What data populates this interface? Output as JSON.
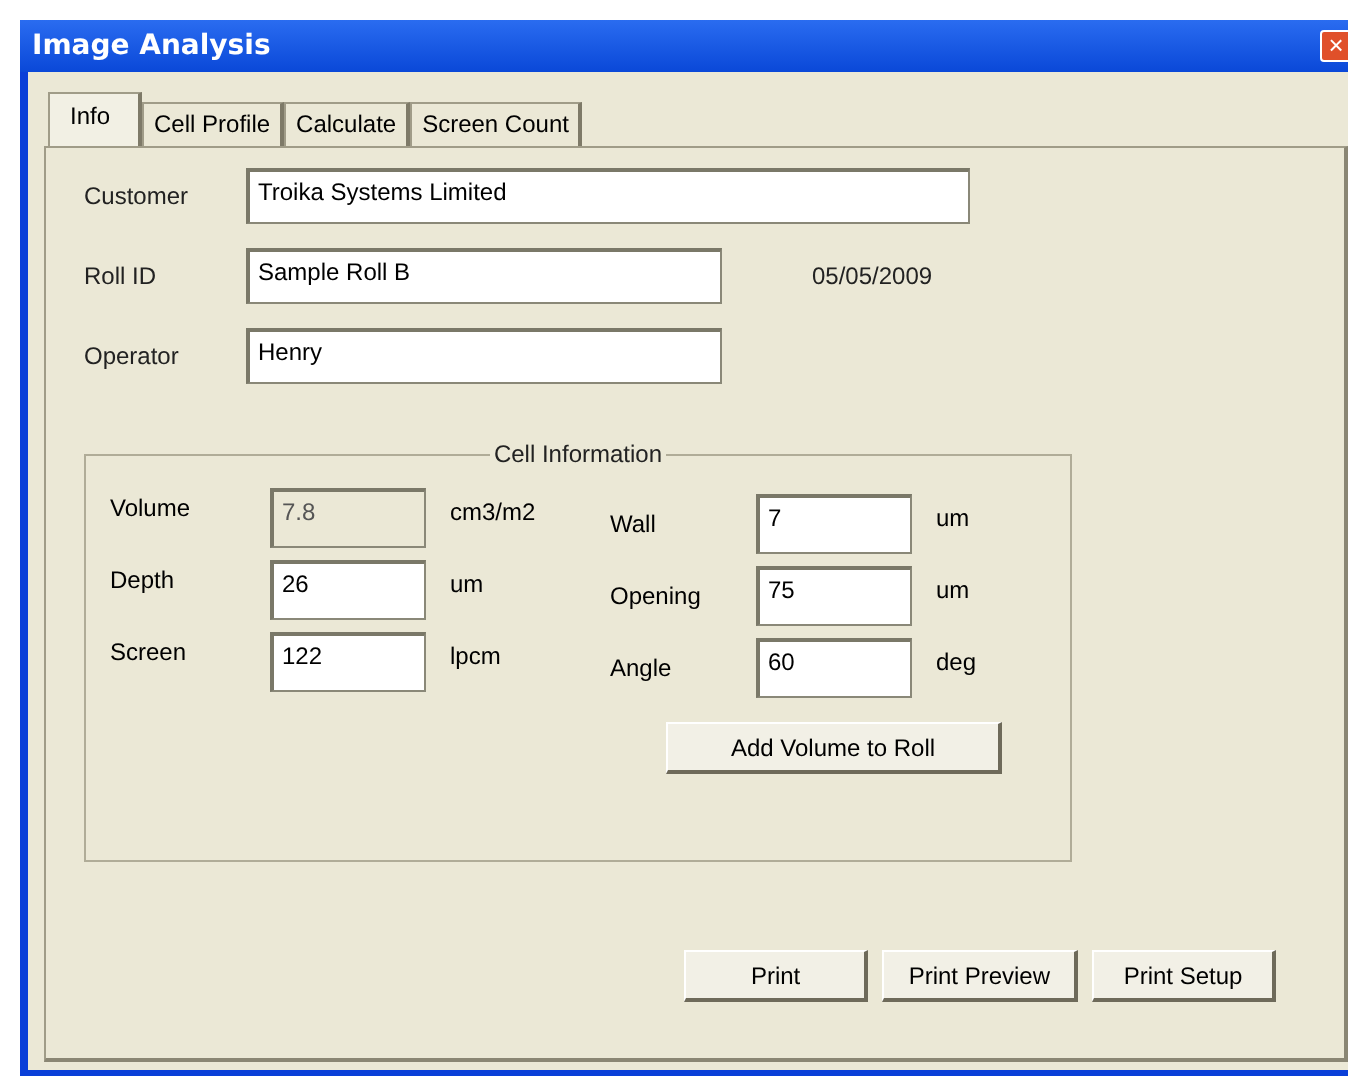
{
  "window": {
    "title": "Image Analysis",
    "close": "×"
  },
  "tabs": [
    {
      "label": "Info",
      "selected": true
    },
    {
      "label": "Cell Profile",
      "selected": false
    },
    {
      "label": "Calculate",
      "selected": false
    },
    {
      "label": "Screen Count",
      "selected": false
    }
  ],
  "fields": [
    {
      "label": "Customer",
      "value": "Troika Systems Limited"
    },
    {
      "label": "Roll ID",
      "value": "Sample Roll B",
      "date": "05/05/2009"
    },
    {
      "label": "Operator",
      "value": "Henry"
    }
  ],
  "cell_information": {
    "title": "Cell Information",
    "left": [
      {
        "label": "Volume",
        "value": "7.8",
        "unit": "cm3/m2",
        "disabled": true
      },
      {
        "label": "Depth",
        "value": "26",
        "unit": "um",
        "disabled": false
      },
      {
        "label": "Screen",
        "value": "122",
        "unit": "lpcm",
        "disabled": false
      }
    ],
    "right": [
      {
        "label": "Wall",
        "value": "7",
        "unit": "um",
        "disabled": false
      },
      {
        "label": "Opening",
        "value": "75",
        "unit": "um",
        "disabled": false
      },
      {
        "label": "Angle",
        "value": "60",
        "unit": "deg",
        "disabled": false
      }
    ],
    "button": "Add Volume to Roll"
  },
  "buttons": [
    "Print",
    "Print Preview",
    "Print Setup"
  ]
}
